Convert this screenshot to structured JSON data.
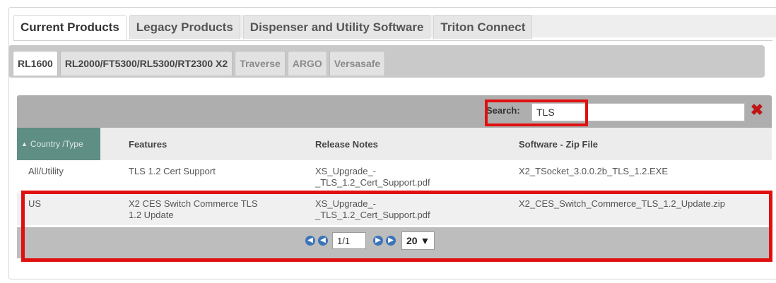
{
  "top_tabs": [
    {
      "label": "Current Products"
    },
    {
      "label": "Legacy Products"
    },
    {
      "label": "Dispenser and Utility Software"
    },
    {
      "label": "Triton Connect"
    }
  ],
  "sub_tabs": [
    {
      "label": "RL1600"
    },
    {
      "label": "RL2000/FT5300/RL5300/RT2300 X2"
    },
    {
      "label": "Traverse"
    },
    {
      "label": "ARGO"
    },
    {
      "label": "Versasafe"
    }
  ],
  "search": {
    "label": "Search:",
    "value": "TLS"
  },
  "clear_icon": "✖",
  "columns": [
    {
      "label": "Country /Type"
    },
    {
      "label": "Features"
    },
    {
      "label": "Release Notes"
    },
    {
      "label": "Software - Zip File"
    }
  ],
  "rows": [
    {
      "country": "All/Utility",
      "feature": "TLS 1.2 Cert Support",
      "notes_line1": "XS_Upgrade_-",
      "notes_line2": "_TLS_1.2_Cert_Support.pdf",
      "software": "X2_TSocket_3.0.0.2b_TLS_1.2.EXE"
    },
    {
      "country": "US",
      "feature_line1": "X2 CES Switch Commerce TLS",
      "feature_line2": "1.2 Update",
      "notes_line1": "XS_Upgrade_-",
      "notes_line2": "_TLS_1.2_Cert_Support.pdf",
      "software": "X2_CES_Switch_Commerce_TLS_1.2_Update.zip"
    }
  ],
  "pager": {
    "first": "◀",
    "prev": "◀",
    "page": "1/1",
    "next": "▶",
    "last": "▶",
    "page_size": "20 ▼"
  },
  "colors": {
    "highlight": "#e01010",
    "sorted_header": "#5f8e84",
    "pager_button": "#3c74b8"
  }
}
